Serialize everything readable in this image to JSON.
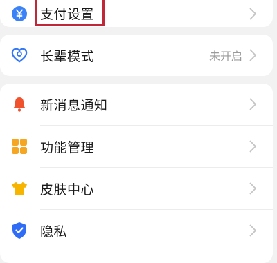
{
  "settings": {
    "payment": {
      "label": "支付设置",
      "icon": "yen-icon",
      "icon_color": "#3b82f6"
    },
    "elder_mode": {
      "label": "长辈模式",
      "value": "未开启",
      "icon": "heart-care-icon",
      "icon_color": "#3478f6"
    },
    "items": [
      {
        "label": "新消息通知",
        "icon": "bell-icon",
        "icon_color": "#f0522e"
      },
      {
        "label": "功能管理",
        "icon": "grid-icon",
        "icon_color": "#f5a623"
      },
      {
        "label": "皮肤中心",
        "icon": "tshirt-icon",
        "icon_color": "#f7b500"
      },
      {
        "label": "隐私",
        "icon": "shield-icon",
        "icon_color": "#2f6df6"
      }
    ]
  },
  "highlight_color": "#c0283a"
}
